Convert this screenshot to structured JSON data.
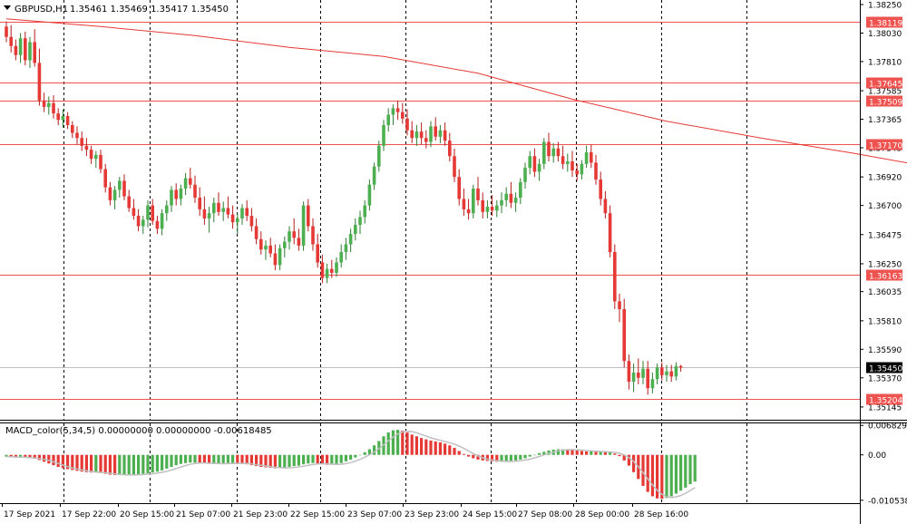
{
  "header": {
    "symbol": "GBPUSD,H1",
    "ohlc": "1.35461 1.35469 1.35417 1.35450"
  },
  "macd_header": "MACD_color(5,34,5) 0.00000000 0.00000000 -0.00618485",
  "colors": {
    "bull": "#4caf50",
    "bull_dark": "#2e7d32",
    "bear": "#e53935",
    "bear_dark": "#b71c1c",
    "ma": "#e53935",
    "level": "#ef5350",
    "grid": "#000000",
    "bid_line": "#c0c0c0",
    "bid_label_bg": "#000000"
  },
  "chart_data": [
    {
      "type": "candlestick",
      "title": "GBPUSD,H1",
      "ylim": [
        1.35085,
        1.3825
      ],
      "y_ticks": [
        "1.38250",
        "1.38030",
        "1.37810",
        "1.37585",
        "1.37365",
        "1.37145",
        "1.36920",
        "1.36700",
        "1.36475",
        "1.36250",
        "1.36035",
        "1.35810",
        "1.35590",
        "1.35370",
        "1.35145"
      ],
      "x_labels": [
        "17 Sep 2021",
        "17 Sep 22:00",
        "20 Sep 15:00",
        "21 Sep 07:00",
        "21 Sep 23:00",
        "22 Sep 15:00",
        "23 Sep 07:00",
        "23 Sep 23:00",
        "24 Sep 15:00",
        "27 Sep 08:00",
        "28 Sep 00:00",
        "28 Sep 16:00"
      ],
      "price_levels": [
        "1.38119",
        "1.37645",
        "1.37509",
        "1.37170",
        "1.36163",
        "1.35204"
      ],
      "current_price": "1.35450",
      "moving_average": [
        [
          0,
          1.3814
        ],
        [
          20,
          1.3808
        ],
        [
          40,
          1.3801
        ],
        [
          60,
          1.3792
        ],
        [
          80,
          1.3785
        ],
        [
          100,
          1.3772
        ],
        [
          120,
          1.3752
        ],
        [
          140,
          1.3735
        ],
        [
          160,
          1.3722
        ],
        [
          180,
          1.371
        ],
        [
          200,
          1.3697
        ],
        [
          210,
          1.3689
        ],
        [
          220,
          1.3672
        ],
        [
          230,
          1.3652
        ]
      ],
      "candles": [
        [
          1.3808,
          1.3812,
          1.3796,
          1.38
        ],
        [
          1.38,
          1.3809,
          1.3788,
          1.3793
        ],
        [
          1.3793,
          1.3798,
          1.3782,
          1.3786
        ],
        [
          1.3786,
          1.3803,
          1.378,
          1.3799
        ],
        [
          1.3799,
          1.3804,
          1.3778,
          1.3782
        ],
        [
          1.3782,
          1.38,
          1.3776,
          1.3796
        ],
        [
          1.3796,
          1.3806,
          1.3777,
          1.378
        ],
        [
          1.378,
          1.3791,
          1.3747,
          1.3751
        ],
        [
          1.3751,
          1.3757,
          1.3742,
          1.3746
        ],
        [
          1.3746,
          1.3754,
          1.374,
          1.3749
        ],
        [
          1.3749,
          1.3755,
          1.3737,
          1.3741
        ],
        [
          1.3741,
          1.3745,
          1.3732,
          1.3736
        ],
        [
          1.3736,
          1.3744,
          1.373,
          1.3739
        ],
        [
          1.3739,
          1.3742,
          1.3729,
          1.3732
        ],
        [
          1.3732,
          1.3735,
          1.3722,
          1.3726
        ],
        [
          1.3726,
          1.3731,
          1.3717,
          1.3722
        ],
        [
          1.3722,
          1.3727,
          1.3712,
          1.3716
        ],
        [
          1.3716,
          1.3722,
          1.3708,
          1.3713
        ],
        [
          1.3713,
          1.3716,
          1.3702,
          1.3706
        ],
        [
          1.3706,
          1.3712,
          1.3699,
          1.3709
        ],
        [
          1.3709,
          1.3713,
          1.3695,
          1.3698
        ],
        [
          1.3698,
          1.3702,
          1.368,
          1.3684
        ],
        [
          1.3684,
          1.3688,
          1.367,
          1.3674
        ],
        [
          1.3674,
          1.3685,
          1.3667,
          1.3682
        ],
        [
          1.3682,
          1.3692,
          1.3676,
          1.3689
        ],
        [
          1.3689,
          1.3694,
          1.3674,
          1.3677
        ],
        [
          1.3677,
          1.3682,
          1.3665,
          1.3668
        ],
        [
          1.3668,
          1.3675,
          1.3659,
          1.3662
        ],
        [
          1.3662,
          1.3667,
          1.365,
          1.3654
        ],
        [
          1.3654,
          1.3662,
          1.3648,
          1.3659
        ],
        [
          1.3659,
          1.3674,
          1.3653,
          1.367
        ],
        [
          1.367,
          1.3675,
          1.3655,
          1.3658
        ],
        [
          1.3658,
          1.3662,
          1.3648,
          1.3652
        ],
        [
          1.3652,
          1.3667,
          1.3647,
          1.3664
        ],
        [
          1.3664,
          1.3674,
          1.3658,
          1.367
        ],
        [
          1.367,
          1.3685,
          1.3665,
          1.3682
        ],
        [
          1.3682,
          1.3687,
          1.367,
          1.3675
        ],
        [
          1.3675,
          1.3686,
          1.367,
          1.3683
        ],
        [
          1.3683,
          1.3695,
          1.3678,
          1.3691
        ],
        [
          1.3691,
          1.3699,
          1.3683,
          1.3686
        ],
        [
          1.3686,
          1.3693,
          1.3672,
          1.3676
        ],
        [
          1.3676,
          1.3684,
          1.3662,
          1.3667
        ],
        [
          1.3667,
          1.3677,
          1.3655,
          1.366
        ],
        [
          1.366,
          1.3669,
          1.3649,
          1.3664
        ],
        [
          1.3664,
          1.3676,
          1.3657,
          1.3672
        ],
        [
          1.3672,
          1.368,
          1.3662,
          1.3665
        ],
        [
          1.3665,
          1.3673,
          1.3658,
          1.3668
        ],
        [
          1.3668,
          1.3677,
          1.366,
          1.3663
        ],
        [
          1.3663,
          1.367,
          1.3652,
          1.3657
        ],
        [
          1.3657,
          1.3664,
          1.3648,
          1.366
        ],
        [
          1.366,
          1.3671,
          1.3655,
          1.3668
        ],
        [
          1.3668,
          1.3674,
          1.3658,
          1.3662
        ],
        [
          1.3662,
          1.3668,
          1.365,
          1.3654
        ],
        [
          1.3654,
          1.366,
          1.364,
          1.3644
        ],
        [
          1.3644,
          1.365,
          1.3632,
          1.3636
        ],
        [
          1.3636,
          1.3643,
          1.3628,
          1.3639
        ],
        [
          1.3639,
          1.3645,
          1.363,
          1.3633
        ],
        [
          1.3633,
          1.364,
          1.362,
          1.3624
        ],
        [
          1.3624,
          1.364,
          1.362,
          1.3637
        ],
        [
          1.3637,
          1.3646,
          1.363,
          1.3642
        ],
        [
          1.3642,
          1.3654,
          1.3636,
          1.365
        ],
        [
          1.365,
          1.366,
          1.364,
          1.3645
        ],
        [
          1.3645,
          1.3652,
          1.3635,
          1.3639
        ],
        [
          1.3639,
          1.3673,
          1.3635,
          1.367
        ],
        [
          1.367,
          1.3675,
          1.365,
          1.3654
        ],
        [
          1.3654,
          1.366,
          1.3635,
          1.364
        ],
        [
          1.364,
          1.3648,
          1.3622,
          1.3626
        ],
        [
          1.3626,
          1.3632,
          1.361,
          1.3614
        ],
        [
          1.3614,
          1.3625,
          1.361,
          1.3621
        ],
        [
          1.3621,
          1.3628,
          1.3614,
          1.3618
        ],
        [
          1.3618,
          1.363,
          1.3615,
          1.3626
        ],
        [
          1.3626,
          1.364,
          1.3622,
          1.3634
        ],
        [
          1.3634,
          1.3645,
          1.3628,
          1.364
        ],
        [
          1.364,
          1.3652,
          1.3634,
          1.3648
        ],
        [
          1.3648,
          1.366,
          1.3643,
          1.3655
        ],
        [
          1.3655,
          1.3666,
          1.3648,
          1.3661
        ],
        [
          1.3661,
          1.3674,
          1.3656,
          1.367
        ],
        [
          1.367,
          1.369,
          1.3666,
          1.3686
        ],
        [
          1.3686,
          1.3703,
          1.3682,
          1.37
        ],
        [
          1.37,
          1.372,
          1.3696,
          1.3716
        ],
        [
          1.3716,
          1.3736,
          1.3712,
          1.3732
        ],
        [
          1.3732,
          1.3745,
          1.3727,
          1.374
        ],
        [
          1.374,
          1.3748,
          1.3732,
          1.3745
        ],
        [
          1.3745,
          1.3751,
          1.3736,
          1.3742
        ],
        [
          1.3742,
          1.3749,
          1.3733,
          1.3737
        ],
        [
          1.3737,
          1.3744,
          1.3724,
          1.3728
        ],
        [
          1.3728,
          1.3735,
          1.3718,
          1.3722
        ],
        [
          1.3722,
          1.3732,
          1.3716,
          1.3727
        ],
        [
          1.3727,
          1.3734,
          1.3717,
          1.3722
        ],
        [
          1.3722,
          1.3728,
          1.3714,
          1.3719
        ],
        [
          1.3719,
          1.3735,
          1.3715,
          1.3731
        ],
        [
          1.3731,
          1.3738,
          1.372,
          1.3723
        ],
        [
          1.3723,
          1.3732,
          1.3718,
          1.3728
        ],
        [
          1.3728,
          1.3734,
          1.3716,
          1.372
        ],
        [
          1.372,
          1.3726,
          1.3704,
          1.3708
        ],
        [
          1.3708,
          1.3714,
          1.3688,
          1.3692
        ],
        [
          1.3692,
          1.3698,
          1.367,
          1.3675
        ],
        [
          1.3675,
          1.3683,
          1.3662,
          1.3667
        ],
        [
          1.3667,
          1.3675,
          1.3659,
          1.3664
        ],
        [
          1.3664,
          1.3686,
          1.366,
          1.3683
        ],
        [
          1.3683,
          1.3692,
          1.367,
          1.3674
        ],
        [
          1.3674,
          1.368,
          1.366,
          1.3665
        ],
        [
          1.3665,
          1.3674,
          1.366,
          1.3669
        ],
        [
          1.3669,
          1.3678,
          1.3662,
          1.3666
        ],
        [
          1.3666,
          1.3674,
          1.3661,
          1.367
        ],
        [
          1.367,
          1.368,
          1.3664,
          1.3674
        ],
        [
          1.3674,
          1.3684,
          1.3669,
          1.3679
        ],
        [
          1.3679,
          1.3688,
          1.3668,
          1.3672
        ],
        [
          1.3672,
          1.368,
          1.3665,
          1.3676
        ],
        [
          1.3676,
          1.3691,
          1.3671,
          1.3688
        ],
        [
          1.3688,
          1.3703,
          1.3683,
          1.3699
        ],
        [
          1.3699,
          1.3712,
          1.3694,
          1.3708
        ],
        [
          1.3708,
          1.3714,
          1.3692,
          1.3696
        ],
        [
          1.3696,
          1.3706,
          1.3689,
          1.3702
        ],
        [
          1.3702,
          1.3722,
          1.3698,
          1.3719
        ],
        [
          1.3719,
          1.3726,
          1.3704,
          1.3708
        ],
        [
          1.3708,
          1.3718,
          1.3703,
          1.3714
        ],
        [
          1.3714,
          1.3719,
          1.3704,
          1.3708
        ],
        [
          1.3708,
          1.3716,
          1.3698,
          1.3702
        ],
        [
          1.3702,
          1.371,
          1.3696,
          1.3704
        ],
        [
          1.3704,
          1.3712,
          1.3692,
          1.3697
        ],
        [
          1.3697,
          1.3702,
          1.3689,
          1.3694
        ],
        [
          1.3694,
          1.3705,
          1.369,
          1.3702
        ],
        [
          1.3702,
          1.3716,
          1.3699,
          1.3711
        ],
        [
          1.3711,
          1.3717,
          1.3699,
          1.3703
        ],
        [
          1.3703,
          1.3709,
          1.3686,
          1.369
        ],
        [
          1.369,
          1.3696,
          1.367,
          1.3675
        ],
        [
          1.3675,
          1.3681,
          1.366,
          1.3664
        ],
        [
          1.3664,
          1.367,
          1.363,
          1.3634
        ],
        [
          1.3634,
          1.364,
          1.359,
          1.3596
        ],
        [
          1.3596,
          1.3602,
          1.358,
          1.359
        ],
        [
          1.359,
          1.3598,
          1.3545,
          1.355
        ],
        [
          1.355,
          1.3555,
          1.3528,
          1.3534
        ],
        [
          1.3534,
          1.3548,
          1.3526,
          1.3541
        ],
        [
          1.3541,
          1.3552,
          1.3532,
          1.3537
        ],
        [
          1.3537,
          1.355,
          1.3532,
          1.3544
        ],
        [
          1.3544,
          1.355,
          1.3524,
          1.3529
        ],
        [
          1.3529,
          1.3541,
          1.3525,
          1.3536
        ],
        [
          1.3536,
          1.3548,
          1.3532,
          1.3545
        ],
        [
          1.3545,
          1.3549,
          1.3535,
          1.3539
        ],
        [
          1.3539,
          1.3547,
          1.3534,
          1.3542
        ],
        [
          1.3542,
          1.3547,
          1.3534,
          1.3538
        ],
        [
          1.3538,
          1.3549,
          1.3535,
          1.3546
        ],
        [
          1.35461,
          1.35469,
          1.35417,
          1.3545
        ]
      ]
    },
    {
      "type": "bar",
      "title": "MACD_color(5,34,5)",
      "ylim": [
        -0.0112,
        0.0073
      ],
      "y_ticks": [
        "0.0068296",
        "0.00",
        "-0.0105387"
      ],
      "values": [
        -0.0004,
        -0.0005,
        -0.0006,
        -0.0006,
        -0.0007,
        -0.0008,
        -0.0009,
        -0.0012,
        -0.0016,
        -0.002,
        -0.0024,
        -0.0028,
        -0.0031,
        -0.0033,
        -0.0035,
        -0.0037,
        -0.0039,
        -0.004,
        -0.0041,
        -0.0041,
        -0.0042,
        -0.0044,
        -0.0046,
        -0.0047,
        -0.0047,
        -0.0047,
        -0.0046,
        -0.0046,
        -0.0045,
        -0.0044,
        -0.0043,
        -0.0041,
        -0.0039,
        -0.0036,
        -0.0032,
        -0.0028,
        -0.0024,
        -0.0021,
        -0.0019,
        -0.0018,
        -0.0018,
        -0.0019,
        -0.002,
        -0.0021,
        -0.0021,
        -0.0021,
        -0.002,
        -0.0019,
        -0.0019,
        -0.002,
        -0.0021,
        -0.0022,
        -0.0024,
        -0.0026,
        -0.0028,
        -0.0029,
        -0.003,
        -0.0031,
        -0.0031,
        -0.003,
        -0.0028,
        -0.0026,
        -0.0025,
        -0.0022,
        -0.002,
        -0.0019,
        -0.002,
        -0.0022,
        -0.0023,
        -0.0023,
        -0.0022,
        -0.0019,
        -0.0015,
        -0.0011,
        -0.0006,
        -0.0001,
        0.0006,
        0.0013,
        0.0022,
        0.0032,
        0.0043,
        0.0052,
        0.0057,
        0.0058,
        0.0056,
        0.0052,
        0.0047,
        0.0043,
        0.0039,
        0.0036,
        0.0033,
        0.0031,
        0.0029,
        0.0026,
        0.0022,
        0.0016,
        0.0009,
        0.0002,
        -0.0004,
        -0.0008,
        -0.0011,
        -0.0013,
        -0.0014,
        -0.0015,
        -0.0016,
        -0.0016,
        -0.0015,
        -0.0014,
        -0.0013,
        -0.0011,
        -0.0008,
        -0.0004,
        0.0,
        0.0004,
        0.0007,
        0.001,
        0.0012,
        0.0013,
        0.0013,
        0.0012,
        0.0011,
        0.001,
        0.0009,
        0.0008,
        0.0008,
        0.0007,
        0.0007,
        0.0006,
        0.0006,
        0.0003,
        -0.0003,
        -0.0013,
        -0.0025,
        -0.004,
        -0.0056,
        -0.0072,
        -0.0086,
        -0.0096,
        -0.0101,
        -0.0102,
        -0.01,
        -0.0096,
        -0.009,
        -0.0083,
        -0.0076,
        -0.0068,
        -0.0062
      ]
    }
  ]
}
